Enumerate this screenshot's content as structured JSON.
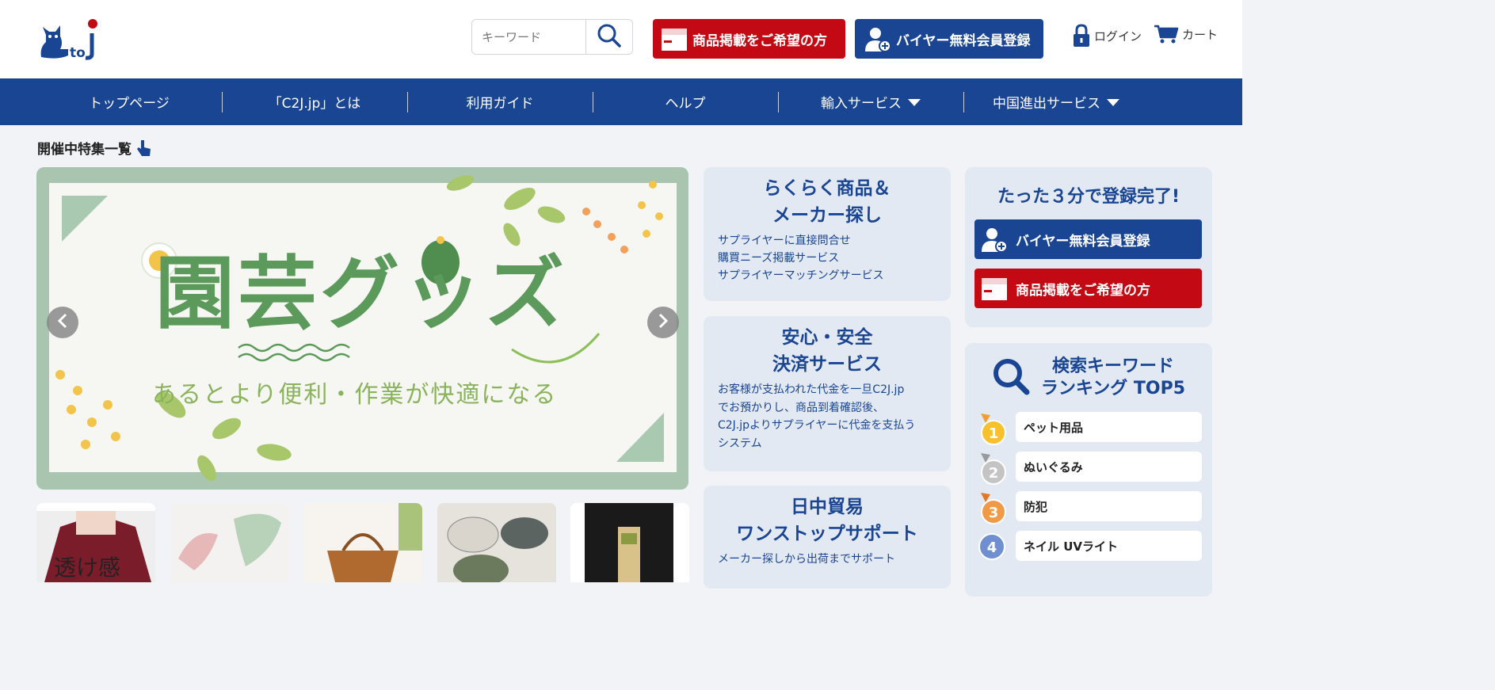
{
  "header": {
    "logo_text": "C to J",
    "search": {
      "placeholder": "キーワード"
    },
    "listing_button": "商品掲載をご希望の方",
    "buyer_button": "バイヤー無料会員登録",
    "login": "ログイン",
    "cart": "カート"
  },
  "nav": {
    "items": [
      {
        "label": "トップページ",
        "dropdown": false
      },
      {
        "label": "「C2J.jp」とは",
        "dropdown": false
      },
      {
        "label": "利用ガイド",
        "dropdown": false
      },
      {
        "label": "ヘルプ",
        "dropdown": false
      },
      {
        "label": "輸入サービス",
        "dropdown": true
      },
      {
        "label": "中国進出サービス",
        "dropdown": true
      }
    ]
  },
  "features_title": "開催中特集一覧",
  "banner": {
    "title": "園芸グッズ",
    "subtitle": "あるとより便利・作業が快適になる"
  },
  "thumbs": [
    {
      "label": "透け感"
    },
    {
      "label": ""
    },
    {
      "label": ""
    },
    {
      "label": ""
    },
    {
      "label": ""
    }
  ],
  "cards": [
    {
      "title": "らくらく商品＆\nメーカー探し",
      "lines": [
        "サプライヤーに直接問合せ",
        "購買ニーズ掲載サービス",
        "サプライヤーマッチングサービス"
      ]
    },
    {
      "title": "安心・安全\n決済サービス",
      "lines": [
        "お客様が支払われた代金を一旦C2J.jp",
        "でお預かりし、商品到着確認後、",
        "C2J.jpよりサプライヤーに代金を支払う",
        "システム"
      ]
    },
    {
      "title": "日中貿易\nワンストップサポート",
      "lines": [
        "メーカー探しから出荷までサポート"
      ]
    }
  ],
  "register_box": {
    "title": "たった３分で登録完了!",
    "buyer_button": "バイヤー無料会員登録",
    "listing_button": "商品掲載をご希望の方"
  },
  "ranking": {
    "title": "検索キーワード\nランキング TOP5",
    "items": [
      {
        "rank": "1",
        "keyword": "ペット用品"
      },
      {
        "rank": "2",
        "keyword": "ぬいぐるみ"
      },
      {
        "rank": "3",
        "keyword": "防犯"
      },
      {
        "rank": "4",
        "keyword": "ネイル UVライト"
      }
    ]
  },
  "colors": {
    "brand_blue": "#1a4592",
    "brand_red": "#c30a14",
    "card_bg": "#e3e9f2",
    "page_bg": "#f1f3f6"
  }
}
